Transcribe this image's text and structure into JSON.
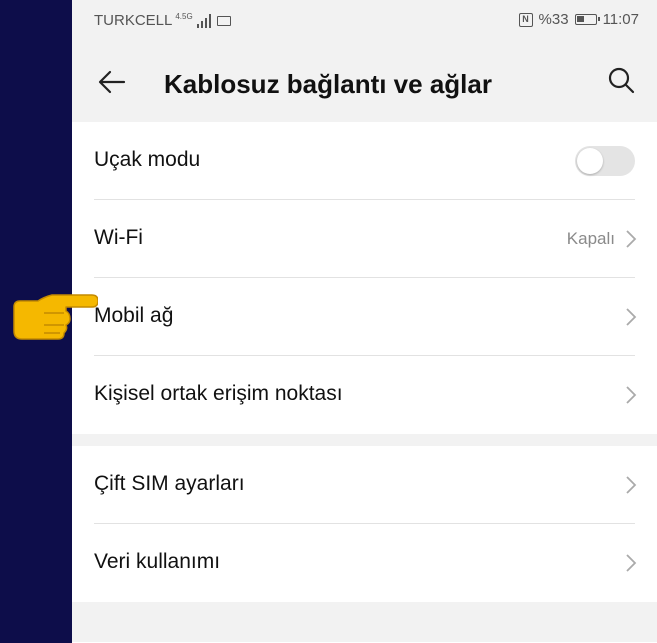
{
  "statusbar": {
    "carrier": "TURKCELL",
    "network": "4.5G",
    "battery_pct": "%33",
    "time": "11:07"
  },
  "header": {
    "title": "Kablosuz bağlantı ve ağlar"
  },
  "settings": [
    {
      "label": "Uçak modu",
      "control": "toggle",
      "toggle_on": false
    },
    {
      "label": "Wi-Fi",
      "value": "Kapalı",
      "control": "chevron"
    },
    {
      "label": "Mobil ağ",
      "control": "chevron"
    },
    {
      "label": "Kişisel ortak erişim noktası",
      "control": "chevron"
    },
    {
      "label": "Çift SIM ayarları",
      "control": "chevron"
    },
    {
      "label": "Veri kullanımı",
      "control": "chevron"
    }
  ],
  "icons": {
    "back": "arrow-left-icon",
    "search": "search-icon",
    "pointer": "pointing-hand-icon"
  },
  "colors": {
    "background": "#0d0d4a",
    "panel": "#f2f2f2",
    "pointer": "#f5b800"
  }
}
